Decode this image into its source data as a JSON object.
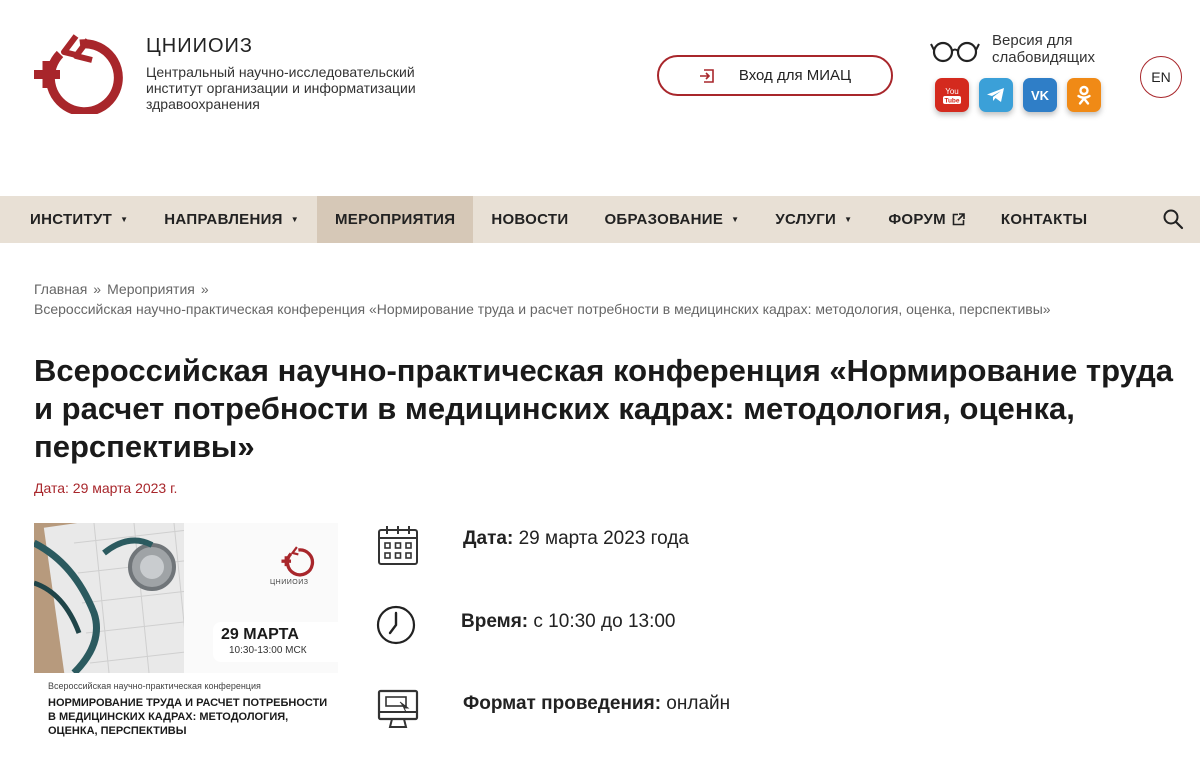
{
  "header": {
    "brand_name": "ЦНИИОИЗ",
    "brand_desc": "Центральный научно-исследовательский институт организации и информатизации здравоохранения",
    "miac_button": "Вход для МИАЦ",
    "vision_version": "Версия для слабовидящих",
    "lang": "EN",
    "brand_color": "#a8262b",
    "social": [
      "youtube-icon",
      "telegram-icon",
      "vk-icon",
      "odnoklassniki-icon"
    ]
  },
  "nav": {
    "items": [
      {
        "label": "ИНСТИТУТ",
        "caret": true
      },
      {
        "label": "НАПРАВЛЕНИЯ",
        "caret": true
      },
      {
        "label": "МЕРОПРИЯТИЯ",
        "active": true
      },
      {
        "label": "НОВОСТИ"
      },
      {
        "label": "ОБРАЗОВАНИЕ",
        "caret": true
      },
      {
        "label": "УСЛУГИ",
        "caret": true
      },
      {
        "label": "ФОРУМ",
        "external": true
      },
      {
        "label": "КОНТАКТЫ"
      }
    ],
    "bg_color": "#e8e0d5",
    "active_color": "#d6c8b7"
  },
  "breadcrumbs": {
    "home": "Главная",
    "section": "Мероприятия",
    "separator": "»",
    "current": "Всероссийская научно-практическая конференция «Нормирование труда и расчет потребности в медицинских кадрах: методология, оценка, перспективы»"
  },
  "article": {
    "title": "Всероссийская научно-практическая конференция «Нормирование труда и расчет потребности в медицинских кадрах: методология, оценка, перспективы»",
    "pub_date": "Дата: 29 марта 2023 г."
  },
  "banner": {
    "brand": "ЦНИИОИЗ",
    "date": "29 МАРТА",
    "time": "10:30-13:00 МСК",
    "conf_type": "Всероссийская научно-практическая конференция",
    "conf_title": "НОРМИРОВАНИЕ ТРУДА И РАСЧЕТ ПОТРЕБНОСТИ В МЕДИЦИНСКИХ КАДРАХ: МЕТОДОЛОГИЯ, ОЦЕНКА, ПЕРСПЕКТИВЫ"
  },
  "details": {
    "date_label": "Дата:",
    "date_value": "29 марта 2023 года",
    "time_label": "Время:",
    "time_value": "с 10:30 до 13:00",
    "format_label": "Формат проведения:",
    "format_value": "онлайн"
  }
}
